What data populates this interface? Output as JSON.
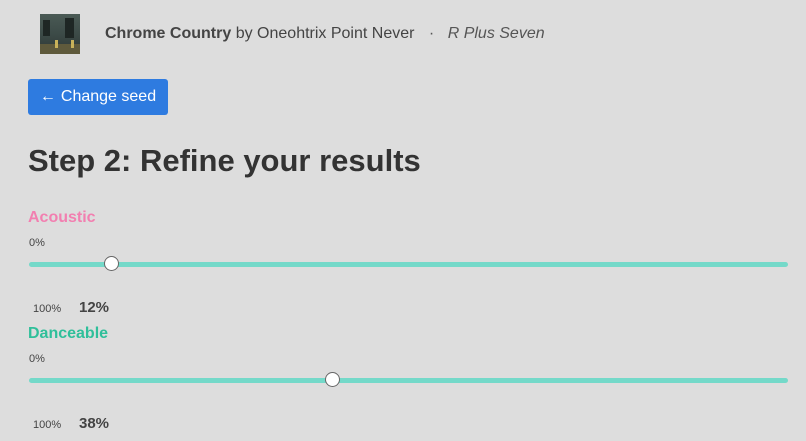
{
  "now_playing": {
    "track": "Chrome Country",
    "by_word": "by",
    "artist": "Oneohtrix Point Never",
    "separator": "·",
    "album": "R Plus Seven"
  },
  "seed_button": {
    "arrow": "←",
    "label": "Change seed",
    "color": "#2e7be0"
  },
  "page": {
    "title": "Step 2: Refine your results"
  },
  "sliders": [
    {
      "label": "Acoustic",
      "color": "#f27fb0",
      "min_label": "0%",
      "max_label": "100%",
      "value_text": "12%",
      "value": 0.11
    },
    {
      "label": "Danceable",
      "color": "#2fbf9a",
      "min_label": "0%",
      "max_label": "100%",
      "value_text": "38%",
      "value": 0.4
    }
  ],
  "track_color": "#74d9c9"
}
